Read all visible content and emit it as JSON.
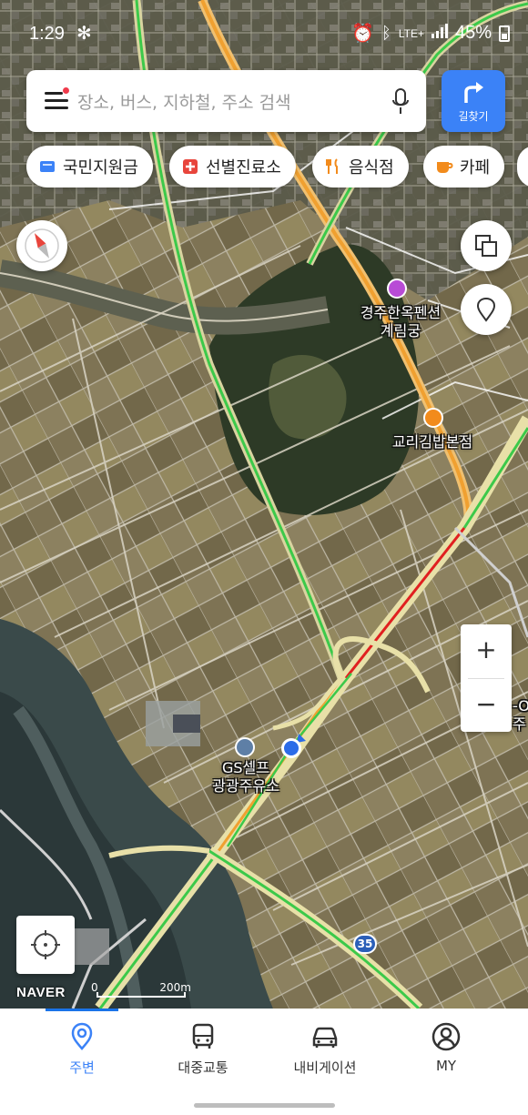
{
  "status_bar": {
    "time": "1:29",
    "battery": "45%",
    "network": "LTE+"
  },
  "search": {
    "placeholder": "장소, 버스, 지하철, 주소 검색",
    "route_label": "길찾기"
  },
  "categories": [
    {
      "label": "국민지원금",
      "icon": "won-card-icon",
      "color": "#3b82f7"
    },
    {
      "label": "선별진료소",
      "icon": "medical-cross-icon",
      "color": "#e8453c"
    },
    {
      "label": "음식점",
      "icon": "fork-knife-icon",
      "color": "#f28b1c"
    },
    {
      "label": "카페",
      "icon": "coffee-cup-icon",
      "color": "#f28b1c"
    }
  ],
  "map": {
    "labels": {
      "pension_line1": "경주한옥펜션",
      "pension_line2": "계림궁",
      "restaurant": "교리김밥본점",
      "gas_line1": "GS셀프",
      "gas_line2": "광광주유소",
      "edge_label_1": "-O",
      "edge_label_2": "주"
    },
    "road_shield": "35",
    "scale": {
      "start": "0",
      "end": "200m"
    },
    "logo": "NAVER",
    "zoom_in": "+",
    "zoom_out": "−"
  },
  "bottom_nav": {
    "items": [
      {
        "label": "주변",
        "icon": "location-pin-icon",
        "active": true
      },
      {
        "label": "대중교통",
        "icon": "bus-icon",
        "active": false
      },
      {
        "label": "내비게이션",
        "icon": "car-icon",
        "active": false
      },
      {
        "label": "MY",
        "icon": "profile-icon",
        "active": false
      }
    ]
  },
  "colors": {
    "accent": "#3b82f7",
    "traffic_green": "#3cc94a",
    "traffic_orange": "#f0a030",
    "traffic_red": "#e02020"
  }
}
